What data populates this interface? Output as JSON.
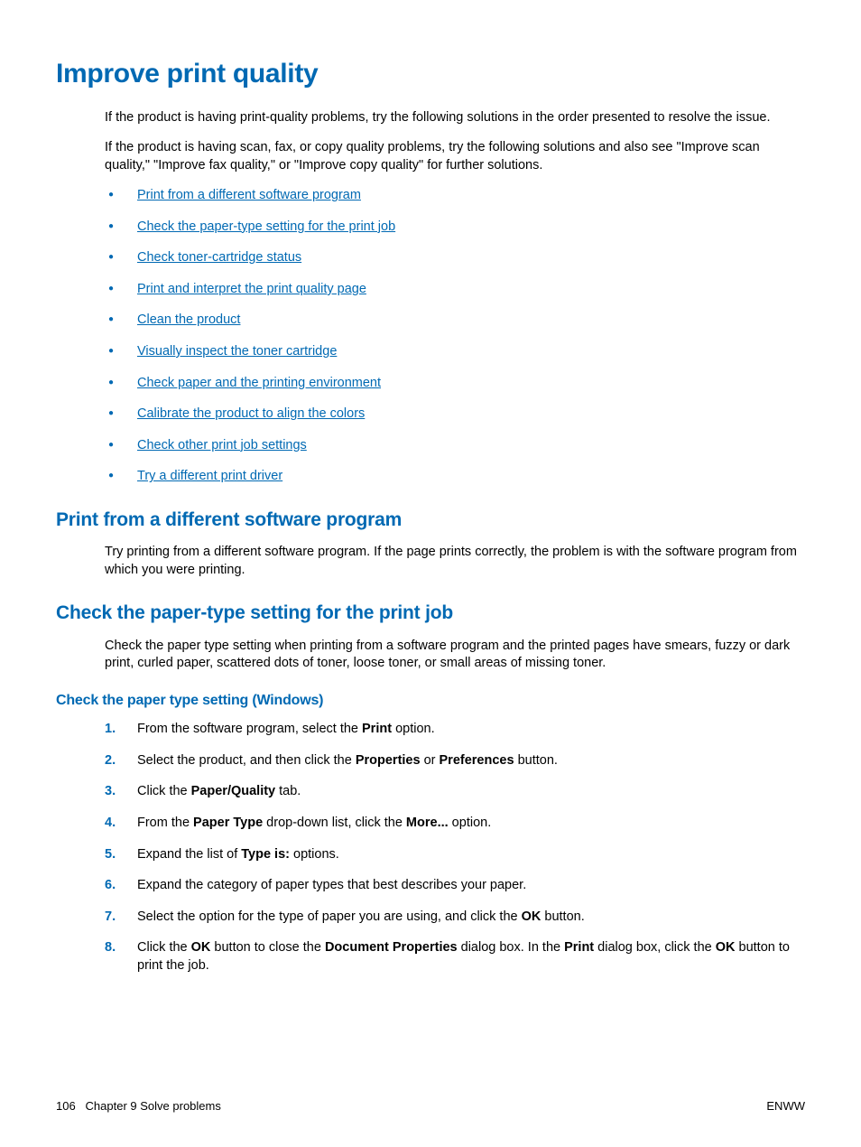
{
  "title": "Improve print quality",
  "intro1": "If the product is having print-quality problems, try the following solutions in the order presented to resolve the issue.",
  "intro2": "If the product is having scan, fax, or copy quality problems, try the following solutions and also see \"Improve scan quality,\" \"Improve fax quality,\" or \"Improve copy quality\" for further solutions.",
  "bullets": [
    "Print from a different software program",
    "Check the paper-type setting for the print job",
    "Check toner-cartridge status",
    "Print and interpret the print quality page",
    "Clean the product",
    "Visually inspect the toner cartridge",
    "Check paper and the printing environment",
    "Calibrate the product to align the colors",
    "Check other print job settings",
    "Try a different print driver"
  ],
  "section1": {
    "heading": "Print from a different software program",
    "body": "Try printing from a different software program. If the page prints correctly, the problem is with the software program from which you were printing."
  },
  "section2": {
    "heading": "Check the paper-type setting for the print job",
    "body": "Check the paper type setting when printing from a software program and the printed pages have smears, fuzzy or dark print, curled paper, scattered dots of toner, loose toner, or small areas of missing toner."
  },
  "section3": {
    "heading": "Check the paper type setting (Windows)"
  },
  "steps": {
    "s1a": "From the software program, select the ",
    "s1b": "Print",
    "s1c": " option.",
    "s2a": "Select the product, and then click the ",
    "s2b": "Properties",
    "s2c": " or ",
    "s2d": "Preferences",
    "s2e": " button.",
    "s3a": "Click the ",
    "s3b": "Paper/Quality",
    "s3c": " tab.",
    "s4a": "From the ",
    "s4b": "Paper Type",
    "s4c": " drop-down list, click the ",
    "s4d": "More...",
    "s4e": " option.",
    "s5a": "Expand the list of ",
    "s5b": "Type is:",
    "s5c": " options.",
    "s6": "Expand the category of paper types that best describes your paper.",
    "s7a": "Select the option for the type of paper you are using, and click the ",
    "s7b": "OK",
    "s7c": " button.",
    "s8a": "Click the ",
    "s8b": "OK",
    "s8c": " button to close the ",
    "s8d": "Document Properties",
    "s8e": " dialog box. In the ",
    "s8f": "Print",
    "s8g": " dialog box, click the ",
    "s8h": "OK",
    "s8i": " button to print the job."
  },
  "footer": {
    "left_page": "106",
    "left_chapter": "Chapter 9   Solve problems",
    "right": "ENWW"
  }
}
